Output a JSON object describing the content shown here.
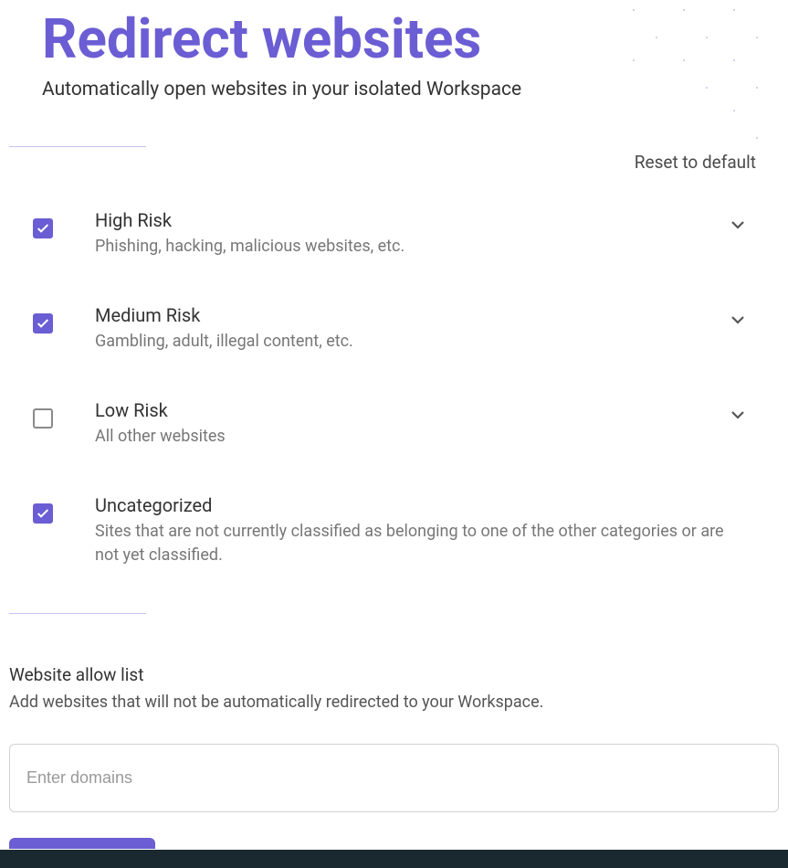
{
  "header": {
    "title": "Redirect websites",
    "subtitle": "Automatically open websites in your isolated Workspace",
    "reset": "Reset to default"
  },
  "categories": [
    {
      "id": "high-risk",
      "title": "High Risk",
      "desc": "Phishing, hacking, malicious websites, etc.",
      "checked": true,
      "expandable": true
    },
    {
      "id": "medium-risk",
      "title": "Medium Risk",
      "desc": "Gambling, adult, illegal content, etc.",
      "checked": true,
      "expandable": true
    },
    {
      "id": "low-risk",
      "title": "Low Risk",
      "desc": "All other websites",
      "checked": false,
      "expandable": true
    },
    {
      "id": "uncategorized",
      "title": "Uncategorized",
      "desc": "Sites that are not currently classified as belonging to one of the other categories or are not yet classified.",
      "checked": true,
      "expandable": false
    }
  ],
  "allowlist": {
    "title": "Website allow list",
    "desc": "Add websites that will not be automatically redirected to your Workspace.",
    "placeholder": "Enter domains"
  }
}
